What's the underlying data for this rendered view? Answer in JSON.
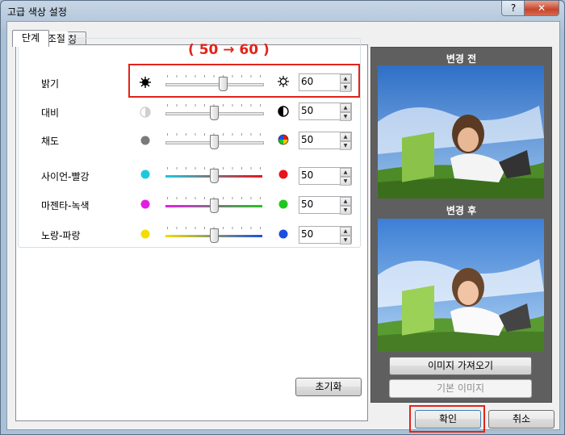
{
  "window": {
    "title": "고급 색상 설정",
    "help_label": "?",
    "close_label": "✕"
  },
  "tabs": [
    {
      "label": "단계",
      "active": true
    },
    {
      "label": "매칭",
      "active": false
    }
  ],
  "group": {
    "label": "단계 조절"
  },
  "rows": [
    {
      "label": "밝기",
      "value": "60",
      "left_icon": "sun-dark-icon",
      "right_icon": "sun-outline-icon"
    },
    {
      "label": "대비",
      "value": "50",
      "left_icon": "low-contrast-icon",
      "right_icon": "contrast-icon"
    },
    {
      "label": "채도",
      "value": "50",
      "left_icon": "gray-dot-icon",
      "right_icon": "color-wheel-icon"
    },
    {
      "label": "사이언-빨강",
      "value": "50",
      "left_color": "#1ec8dc",
      "right_color": "#e8141a"
    },
    {
      "label": "마젠타-녹색",
      "value": "50",
      "left_color": "#e21ee2",
      "right_color": "#1ec81e"
    },
    {
      "label": "노랑-파랑",
      "value": "50",
      "left_color": "#f4dc00",
      "right_color": "#1a50e0"
    }
  ],
  "reset_button": "초기화",
  "preview": {
    "before_label": "변경 전",
    "after_label": "변경 후",
    "load_image_button": "이미지 가져오기",
    "default_image_button": "기본 이미지"
  },
  "footer": {
    "ok_button": "확인",
    "cancel_button": "취소"
  },
  "annotation": {
    "text": "( 50 → 60 )",
    "color": "#e2231a"
  }
}
